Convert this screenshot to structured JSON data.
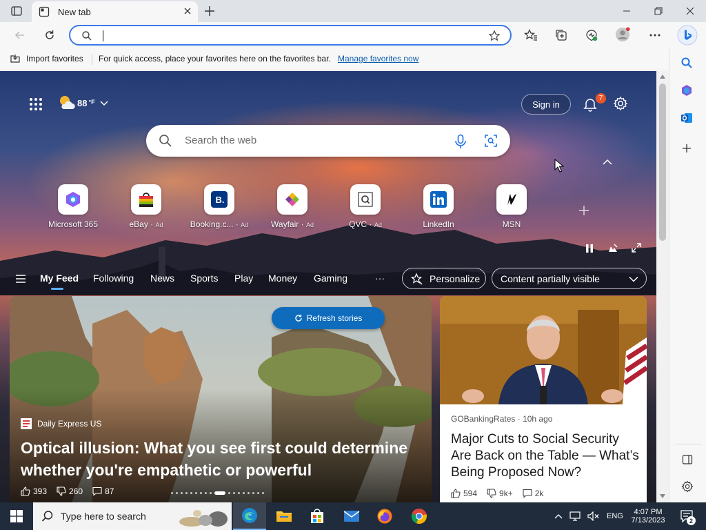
{
  "tab": {
    "title": "New tab"
  },
  "address": {
    "value": ""
  },
  "favbar": {
    "import_label": "Import favorites",
    "message": "For quick access, place your favorites here on the favorites bar.",
    "manage_link": "Manage favorites now"
  },
  "header": {
    "weather_temp": "88",
    "weather_unit": "°F",
    "signin_label": "Sign in",
    "notification_count": "7"
  },
  "search": {
    "placeholder": "Search the web"
  },
  "quicklinks": [
    {
      "label": "Microsoft 365",
      "ad": "",
      "icon": "microsoft-365-icon"
    },
    {
      "label": "eBay",
      "ad": "Ad",
      "icon": "ebay-icon"
    },
    {
      "label": "Booking.c...",
      "ad": "Ad",
      "icon": "booking-icon"
    },
    {
      "label": "Wayfair",
      "ad": "Ad",
      "icon": "wayfair-icon"
    },
    {
      "label": "QVC",
      "ad": "Ad",
      "icon": "qvc-icon"
    },
    {
      "label": "LinkedIn",
      "ad": "",
      "icon": "linkedin-icon"
    },
    {
      "label": "MSN",
      "ad": "",
      "icon": "msn-icon"
    }
  ],
  "feed": {
    "tabs": [
      "My Feed",
      "Following",
      "News",
      "Sports",
      "Play",
      "Money",
      "Gaming"
    ],
    "more": "···",
    "personalize_label": "Personalize",
    "visibility_label": "Content partially visible",
    "refresh_label": "Refresh stories"
  },
  "main_card": {
    "source": "Daily Express US",
    "title": "Optical illusion: What you see first could determine whether you're empathetic or powerful",
    "likes": "393",
    "dislikes": "260",
    "comments": "87"
  },
  "side_card": {
    "source": "GOBankingRates",
    "age": "10h ago",
    "title": "Major Cuts to Social Security Are Back on the Table — What’s Being Proposed Now?",
    "likes": "594",
    "dislikes": "9k+",
    "comments": "2k"
  },
  "taskbar": {
    "search_placeholder": "Type here to search",
    "lang": "ENG",
    "time": "4:07 PM",
    "date": "7/13/2023",
    "notifications": "2"
  },
  "colors": {
    "accent": "#0f6cbd",
    "taskbar": "#202c3c",
    "badge": "#e8562a"
  }
}
